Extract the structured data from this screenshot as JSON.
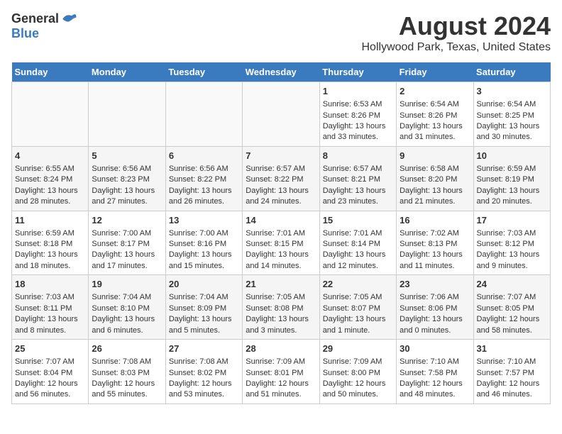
{
  "header": {
    "logo_general": "General",
    "logo_blue": "Blue",
    "title": "August 2024",
    "subtitle": "Hollywood Park, Texas, United States"
  },
  "days_of_week": [
    "Sunday",
    "Monday",
    "Tuesday",
    "Wednesday",
    "Thursday",
    "Friday",
    "Saturday"
  ],
  "weeks": [
    [
      {
        "day": "",
        "content": ""
      },
      {
        "day": "",
        "content": ""
      },
      {
        "day": "",
        "content": ""
      },
      {
        "day": "",
        "content": ""
      },
      {
        "day": "1",
        "content": "Sunrise: 6:53 AM\nSunset: 8:26 PM\nDaylight: 13 hours and 33 minutes."
      },
      {
        "day": "2",
        "content": "Sunrise: 6:54 AM\nSunset: 8:26 PM\nDaylight: 13 hours and 31 minutes."
      },
      {
        "day": "3",
        "content": "Sunrise: 6:54 AM\nSunset: 8:25 PM\nDaylight: 13 hours and 30 minutes."
      }
    ],
    [
      {
        "day": "4",
        "content": "Sunrise: 6:55 AM\nSunset: 8:24 PM\nDaylight: 13 hours and 28 minutes."
      },
      {
        "day": "5",
        "content": "Sunrise: 6:56 AM\nSunset: 8:23 PM\nDaylight: 13 hours and 27 minutes."
      },
      {
        "day": "6",
        "content": "Sunrise: 6:56 AM\nSunset: 8:22 PM\nDaylight: 13 hours and 26 minutes."
      },
      {
        "day": "7",
        "content": "Sunrise: 6:57 AM\nSunset: 8:22 PM\nDaylight: 13 hours and 24 minutes."
      },
      {
        "day": "8",
        "content": "Sunrise: 6:57 AM\nSunset: 8:21 PM\nDaylight: 13 hours and 23 minutes."
      },
      {
        "day": "9",
        "content": "Sunrise: 6:58 AM\nSunset: 8:20 PM\nDaylight: 13 hours and 21 minutes."
      },
      {
        "day": "10",
        "content": "Sunrise: 6:59 AM\nSunset: 8:19 PM\nDaylight: 13 hours and 20 minutes."
      }
    ],
    [
      {
        "day": "11",
        "content": "Sunrise: 6:59 AM\nSunset: 8:18 PM\nDaylight: 13 hours and 18 minutes."
      },
      {
        "day": "12",
        "content": "Sunrise: 7:00 AM\nSunset: 8:17 PM\nDaylight: 13 hours and 17 minutes."
      },
      {
        "day": "13",
        "content": "Sunrise: 7:00 AM\nSunset: 8:16 PM\nDaylight: 13 hours and 15 minutes."
      },
      {
        "day": "14",
        "content": "Sunrise: 7:01 AM\nSunset: 8:15 PM\nDaylight: 13 hours and 14 minutes."
      },
      {
        "day": "15",
        "content": "Sunrise: 7:01 AM\nSunset: 8:14 PM\nDaylight: 13 hours and 12 minutes."
      },
      {
        "day": "16",
        "content": "Sunrise: 7:02 AM\nSunset: 8:13 PM\nDaylight: 13 hours and 11 minutes."
      },
      {
        "day": "17",
        "content": "Sunrise: 7:03 AM\nSunset: 8:12 PM\nDaylight: 13 hours and 9 minutes."
      }
    ],
    [
      {
        "day": "18",
        "content": "Sunrise: 7:03 AM\nSunset: 8:11 PM\nDaylight: 13 hours and 8 minutes."
      },
      {
        "day": "19",
        "content": "Sunrise: 7:04 AM\nSunset: 8:10 PM\nDaylight: 13 hours and 6 minutes."
      },
      {
        "day": "20",
        "content": "Sunrise: 7:04 AM\nSunset: 8:09 PM\nDaylight: 13 hours and 5 minutes."
      },
      {
        "day": "21",
        "content": "Sunrise: 7:05 AM\nSunset: 8:08 PM\nDaylight: 13 hours and 3 minutes."
      },
      {
        "day": "22",
        "content": "Sunrise: 7:05 AM\nSunset: 8:07 PM\nDaylight: 13 hours and 1 minute."
      },
      {
        "day": "23",
        "content": "Sunrise: 7:06 AM\nSunset: 8:06 PM\nDaylight: 13 hours and 0 minutes."
      },
      {
        "day": "24",
        "content": "Sunrise: 7:07 AM\nSunset: 8:05 PM\nDaylight: 12 hours and 58 minutes."
      }
    ],
    [
      {
        "day": "25",
        "content": "Sunrise: 7:07 AM\nSunset: 8:04 PM\nDaylight: 12 hours and 56 minutes."
      },
      {
        "day": "26",
        "content": "Sunrise: 7:08 AM\nSunset: 8:03 PM\nDaylight: 12 hours and 55 minutes."
      },
      {
        "day": "27",
        "content": "Sunrise: 7:08 AM\nSunset: 8:02 PM\nDaylight: 12 hours and 53 minutes."
      },
      {
        "day": "28",
        "content": "Sunrise: 7:09 AM\nSunset: 8:01 PM\nDaylight: 12 hours and 51 minutes."
      },
      {
        "day": "29",
        "content": "Sunrise: 7:09 AM\nSunset: 8:00 PM\nDaylight: 12 hours and 50 minutes."
      },
      {
        "day": "30",
        "content": "Sunrise: 7:10 AM\nSunset: 7:58 PM\nDaylight: 12 hours and 48 minutes."
      },
      {
        "day": "31",
        "content": "Sunrise: 7:10 AM\nSunset: 7:57 PM\nDaylight: 12 hours and 46 minutes."
      }
    ]
  ]
}
